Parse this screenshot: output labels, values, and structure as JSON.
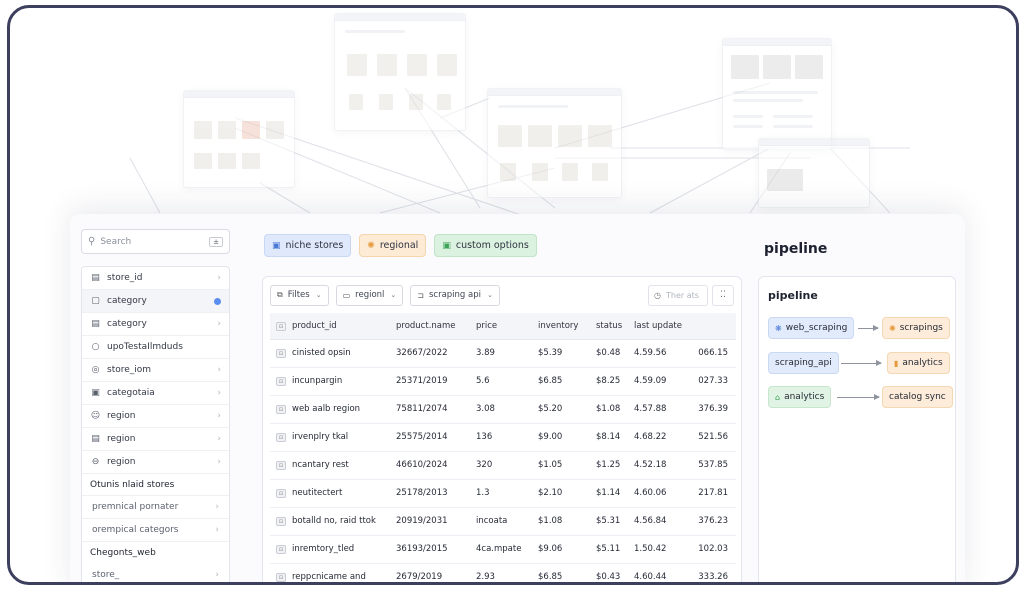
{
  "sidebar": {
    "search_placeholder": "Search",
    "search_shortcut": "±",
    "items": [
      {
        "label": "store_id",
        "icon": "table-icon",
        "glyph": "▤"
      },
      {
        "label": "category",
        "icon": "tag-icon",
        "glyph": "▢"
      },
      {
        "label": "category",
        "icon": "table-icon",
        "glyph": "▤"
      },
      {
        "label": "upoTestaIlmduds",
        "icon": "circle-icon",
        "glyph": "○"
      },
      {
        "label": "store_iom",
        "icon": "target-icon",
        "glyph": "◎"
      },
      {
        "label": "categotaia",
        "icon": "folder-icon",
        "glyph": "▣"
      },
      {
        "label": "region",
        "icon": "user-icon",
        "glyph": "☺"
      },
      {
        "label": "region",
        "icon": "table-icon",
        "glyph": "▤"
      },
      {
        "label": "region",
        "icon": "link-icon",
        "glyph": "⊖"
      }
    ],
    "section1_title": "Otunis nlaid stores",
    "section1_items": [
      "premnical pornater",
      "orempical categors"
    ],
    "section2_title": "Chegonts_web",
    "section2_items": [
      "store_"
    ]
  },
  "chips": [
    {
      "label": "niche stores",
      "glyph": "▣",
      "icon": "store-icon"
    },
    {
      "label": "regional",
      "glyph": "✺",
      "icon": "sun-icon"
    },
    {
      "label": "custom options",
      "glyph": "▣",
      "icon": "options-icon"
    }
  ],
  "page_title": "pipeline",
  "toolbar": {
    "filters_label": "Filtes",
    "region_label": "regionl",
    "api_label": "scraping api",
    "filter_placeholder": "Ther ats"
  },
  "table": {
    "columns": [
      "product_id",
      "product.name",
      "price",
      "inventory",
      "status",
      "last update",
      ""
    ],
    "rows": [
      [
        "cinisted opsin",
        "32667/2022",
        "3.89",
        "$5.39",
        "$0.48",
        "4.59.56",
        "066.15"
      ],
      [
        "incunpargin",
        "25371/2019",
        "5.6",
        "$6.85",
        "$8.25",
        "4.59.09",
        "027.33"
      ],
      [
        "web aalb region",
        "75811/2074",
        "3.08",
        "$5.20",
        "$1.08",
        "4.57.88",
        "376.39"
      ],
      [
        "irvenplry tkal",
        "25575/2014",
        "136",
        "$9.00",
        "$8.14",
        "4.68.22",
        "521.56"
      ],
      [
        "ncantary rest",
        "46610/2024",
        "320",
        "$1.05",
        "$1.25",
        "4.52.18",
        "537.85"
      ],
      [
        "neutitectert",
        "25178/2013",
        "1.3",
        "$2.10",
        "$1.14",
        "4.60.06",
        "217.81"
      ],
      [
        "botalld no, raid ttok",
        "20919/2031",
        "incoata",
        "$1.08",
        "$5.31",
        "4.56.84",
        "376.23"
      ],
      [
        "inremtory_tled",
        "36193/2015",
        "4ca.mpate",
        "$9.06",
        "$5.11",
        "1.50.42",
        "102.03"
      ],
      [
        "reppcnicame and",
        "2679/2019",
        "2.93",
        "$6.85",
        "$0.43",
        "4.60.44",
        "333.26"
      ]
    ]
  },
  "pipeline": {
    "title": "pipeline",
    "nodes": [
      {
        "from": "web_scraping",
        "from_glyph": "❋",
        "from_icon": "web-icon",
        "to": "scrapings",
        "to_glyph": "✺",
        "to_icon": "gear-icon"
      },
      {
        "from": "scraping_api",
        "from_glyph": "",
        "from_icon": "",
        "to": "analytics",
        "to_glyph": "▮",
        "to_icon": "document-icon"
      },
      {
        "from": "analytics",
        "from_glyph": "⌂",
        "from_icon": "chart-icon",
        "to": "catalog sync",
        "to_glyph": "",
        "to_icon": ""
      }
    ]
  },
  "colors": {
    "frame_border": "#3d3f5e",
    "accent_blue": "#5b8def",
    "update_green": "#3e9d4f"
  }
}
